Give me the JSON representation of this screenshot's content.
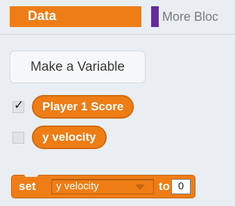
{
  "categories": {
    "active": {
      "label": "Data",
      "color": "#ee7d16"
    },
    "next": {
      "label": "More Bloc",
      "color": "#632d99"
    }
  },
  "make_variable": {
    "label": "Make a Variable"
  },
  "variables": [
    {
      "name": "Player 1 Score",
      "checked": true,
      "check_glyph": "✓"
    },
    {
      "name": "y velocity",
      "checked": false
    }
  ],
  "set_block": {
    "set_label": "set",
    "variable": "y velocity",
    "to_label": "to",
    "value": "0",
    "color": "#ee7d16"
  }
}
